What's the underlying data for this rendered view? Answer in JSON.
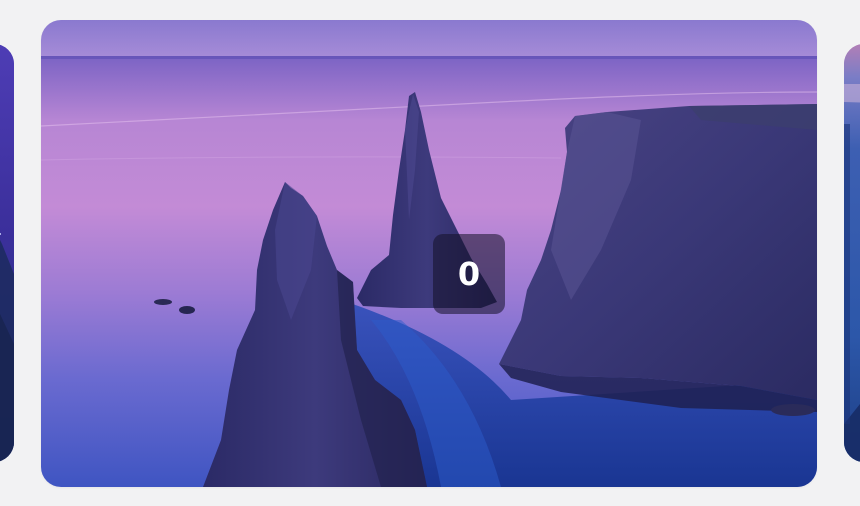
{
  "carousel": {
    "counter_value": "0",
    "slides": [
      {
        "name": "previous-slide",
        "icon": "landscape-image"
      },
      {
        "name": "current-slide",
        "icon": "sea-stacks-image"
      },
      {
        "name": "next-slide",
        "icon": "landscape-image"
      }
    ]
  },
  "colors": {
    "background": "#f2f2f3",
    "counter_overlay": "#14102899",
    "counter_text": "#ffffff"
  }
}
